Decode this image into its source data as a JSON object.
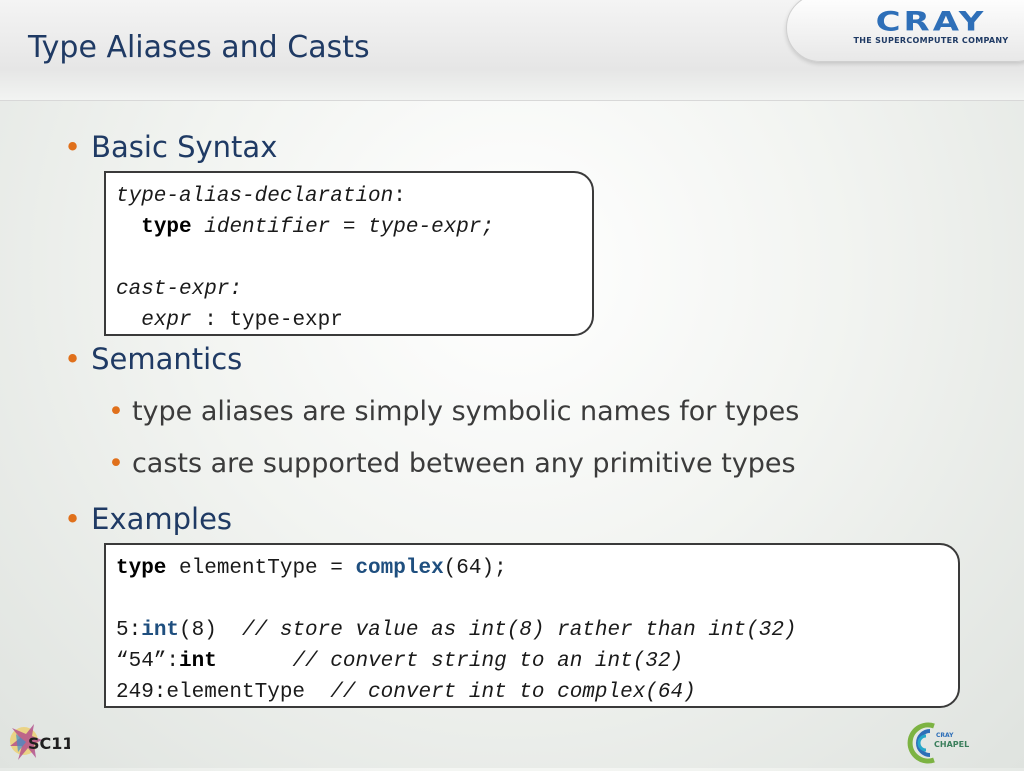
{
  "slide": {
    "title": "Type Aliases and Casts"
  },
  "logo": {
    "word": "CRAY",
    "tagline": "THE SUPERCOMPUTER COMPANY",
    "brand_color": "#2e6fb8"
  },
  "bullets": {
    "basic_syntax": "Basic Syntax",
    "semantics": "Semantics",
    "sem_1": "type aliases are simply symbolic names for types",
    "sem_2": "casts are supported between any primitive types",
    "examples": "Examples",
    "bullet_color": "#e0701b"
  },
  "syntax_box": {
    "l1_term": "type-alias-declaration",
    "l1_colon": ":",
    "l2_kw": "type",
    "l2_rest": "identifier = type-expr;",
    "l4_term": "cast-expr:",
    "l5_expr": "expr",
    "l5_rest": " : type-expr"
  },
  "examples_box": {
    "l1_kw": "type",
    "l1_mid": " elementType = ",
    "l1_kw2": "complex",
    "l1_end": "(64);",
    "l3_a": "5:",
    "l3_kw": "int",
    "l3_b": "(8)  ",
    "l3_comment": "// store value as int(8) rather than int(32)",
    "l4_a": "“54”:",
    "l4_kw": "int",
    "l4_b": "      ",
    "l4_comment": "// convert string to an int(32)",
    "l5_a": "249:elementType  ",
    "l5_comment": "// convert int to complex(64)"
  },
  "footer": {
    "left_logo": "SC11",
    "right_logo_top": "CRAY",
    "right_logo_bottom": "CHAPEL"
  }
}
